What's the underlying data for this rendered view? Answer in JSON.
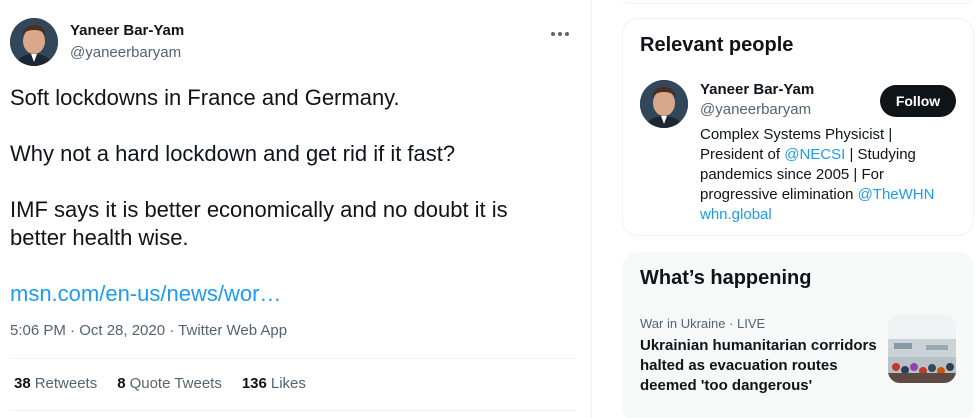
{
  "tweet": {
    "author_name": "Yaneer Bar-Yam",
    "author_handle": "@yaneerbaryam",
    "paragraphs": [
      "Soft lockdowns in France and Germany.",
      "Why not a hard lockdown and get rid if it fast?",
      "IMF says it is better economically and no doubt it is better health wise."
    ],
    "link": "msn.com/en-us/news/wor…",
    "timestamp": "5:06 PM · Oct 28, 2020",
    "source_sep": " · ",
    "source": "Twitter Web App",
    "stats": {
      "retweets_count": "38",
      "retweets_label": "Retweets",
      "quotes_count": "8",
      "quotes_label": "Quote Tweets",
      "likes_count": "136",
      "likes_label": "Likes"
    }
  },
  "sidebar": {
    "relevant_people": {
      "title": "Relevant people",
      "name": "Yaneer Bar-Yam",
      "handle": "@yaneerbaryam",
      "follow_label": "Follow",
      "bio": {
        "line1": "Complex Systems Physicist |",
        "line2_pre": "President of ",
        "line2_link": "@NECSI",
        "line2_post": " | Studying",
        "line3": "pandemics since 2005 | For",
        "line4_pre": "progressive elimination ",
        "line4_link": "@TheWHN",
        "line5_link": "whn.global"
      }
    },
    "whats_happening": {
      "title": "What’s happening",
      "context": "War in Ukraine · LIVE",
      "headline_lines": [
        "Ukrainian humanitarian corridors",
        "halted as evacuation routes",
        "deemed 'too dangerous'"
      ]
    }
  },
  "icons": {
    "more": "more-horizontal-icon"
  },
  "colors": {
    "link": "#1d9bf0",
    "text": "#0f1419",
    "muted": "#536471",
    "follow_bg": "#0f1419"
  }
}
